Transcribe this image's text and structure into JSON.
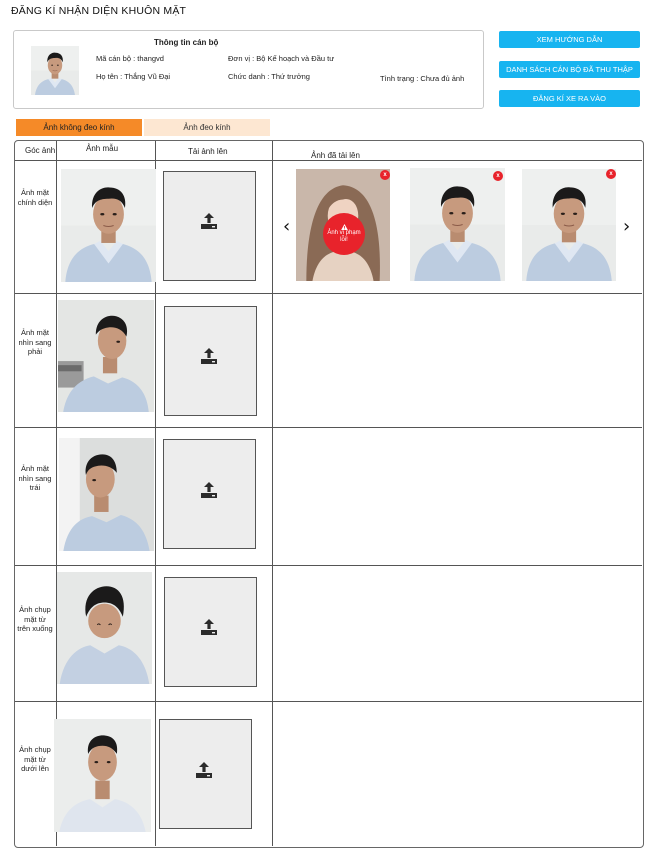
{
  "page_title": "ĐĂNG KÍ NHẬN DIỆN KHUÔN MẶT",
  "info": {
    "heading": "Thông tin cán bộ",
    "ma_can_bo": "Mã cán bộ : thangvd",
    "ho_ten": "Họ tên : Thắng Vũ Đại",
    "don_vi": "Đơn vị : Bộ Kế hoạch và Đầu tư",
    "chuc_danh": "Chức danh : Thứ trưởng",
    "tinh_trang": "Tình trạng : Chưa đủ ảnh"
  },
  "actions": {
    "guide": "XEM HƯỚNG DẪN",
    "collected_list": "DANH SÁCH CÁN BỘ ĐÃ THU THẬP",
    "vehicle_register": "ĐĂNG KÍ XE RA VÀO"
  },
  "tabs": {
    "no_glasses": "Ảnh không đeo kính",
    "with_glasses": "Ảnh đeo kính"
  },
  "columns": {
    "angle": "Góc ảnh",
    "sample": "Ảnh mẫu",
    "upload": "Tải ảnh lên",
    "uploaded": "Ảnh đã tải lên"
  },
  "rows": [
    {
      "label": "Ảnh mặt chính diện"
    },
    {
      "label": "Ảnh mặt nhìn sang phải"
    },
    {
      "label": "Ảnh mặt nhìn sang trái"
    },
    {
      "label": "Ảnh chụp mặt từ trên xuống"
    },
    {
      "label": "Ảnh chụp mặt từ dưới lên"
    }
  ],
  "uploaded": {
    "remove_glyph": "x",
    "violation_text": "Ảnh vi phạm lỗi!",
    "prev_glyph": "‹",
    "next_glyph": "›"
  },
  "colors": {
    "accent_blue": "#17b4f0",
    "tab_orange": "#f58a28",
    "tab_peach": "#fde7d2",
    "error_red": "#e8232b"
  },
  "icons": {
    "upload": "upload-icon",
    "remove": "close-icon",
    "warning": "warning-icon",
    "prev": "chevron-left-icon",
    "next": "chevron-right-icon"
  }
}
